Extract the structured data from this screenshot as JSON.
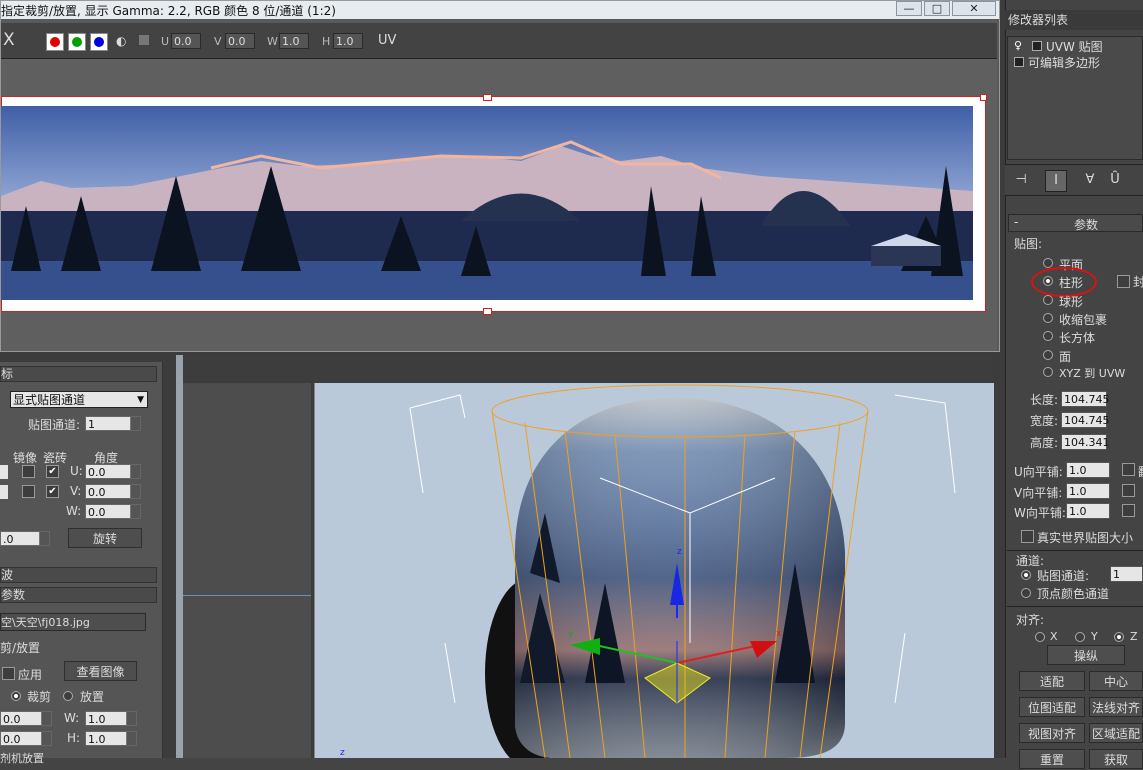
{
  "dialog": {
    "title": "指定裁剪/放置, 显示 Gamma: 2.2, RGB 颜色 8 位/通道 (1:2)",
    "win_buttons": {
      "minimize": "—",
      "maximize": "□",
      "close": "✕"
    },
    "toolbar": {
      "close_glyph": "X",
      "u_label": "U",
      "u_value": "0.0",
      "v_label": "V",
      "v_value": "0.0",
      "w_label": "W",
      "w_value": "1.0",
      "h_label": "H",
      "h_value": "1.0",
      "uv_label": "UV"
    }
  },
  "left_panel": {
    "rollout_1": "标",
    "map_channel_dropdown": "显式贴图通道",
    "map_channel_label": "贴图通道:",
    "map_channel_value": "1",
    "mirror_label": "镜像",
    "tile_label": "瓷砖",
    "angle_label": "角度",
    "u_label": "U:",
    "u_angle": "0.0",
    "v_label": "V:",
    "v_angle": "0.0",
    "w_label": "W:",
    "w_angle": "0.0",
    "blur_value": ".0",
    "rotate_button": "旋转",
    "rollout_2": "波",
    "rollout_3": "参数",
    "bitmap_path": "空\\天空\\fj018.jpg",
    "crop_group_label": "剪/放置",
    "apply_label": "应用",
    "view_image_button": "查看图像",
    "crop_label": "裁剪",
    "place_label": "放置",
    "u_offset": "0.0",
    "v_offset": "0.0",
    "w_label2": "W:",
    "w_value": "1.0",
    "h_label2": "H:",
    "h_value": "1.0",
    "jitter_label": "剂机放置"
  },
  "right_panel": {
    "modifier_list": "修改器列表",
    "stack": [
      "UVW 贴图",
      "可编辑多边形"
    ],
    "params_title": "参数",
    "mapping_label": "贴图:",
    "mapping_options": [
      "平面",
      "柱形",
      "球形",
      "收缩包裹",
      "长方体",
      "面",
      "XYZ 到 UVW"
    ],
    "mapping_selected": "柱形",
    "cap_label": "封",
    "length_label": "长度:",
    "length_value": "104.745",
    "width_label": "宽度:",
    "width_value": "104.745",
    "height_label": "高度:",
    "height_value": "104.341",
    "u_tile_label": "U向平铺:",
    "u_tile": "1.0",
    "v_tile_label": "V向平铺:",
    "v_tile": "1.0",
    "w_tile_label": "W向平铺:",
    "w_tile": "1.0",
    "flip_label": "翻",
    "real_world_label": "真实世界贴图大小",
    "channel_group": "通道:",
    "map_channel_label": "贴图通道:",
    "map_channel_value": "1",
    "vertex_color_label": "顶点颜色通道",
    "align_group": "对齐:",
    "axis_x": "X",
    "axis_y": "Y",
    "axis_z": "Z",
    "manipulate_button": "操纵",
    "fit_button": "适配",
    "center_button": "中心",
    "bitmap_fit_button": "位图适配",
    "normal_align_button": "法线对齐",
    "view_align_button": "视图对齐",
    "region_fit_button": "区域适配",
    "reset_button": "重置",
    "acquire_button": "获取"
  },
  "viewport": {
    "gizmo_axis_x": "x",
    "gizmo_axis_y": "y",
    "gizmo_axis_z": "z",
    "corner_axis": "z"
  },
  "colors": {
    "red_channel": "#e00000",
    "green_channel": "#00a000",
    "blue_channel": "#0000e0",
    "gizmo": "#f0a020",
    "selection_circle": "#e01010"
  }
}
